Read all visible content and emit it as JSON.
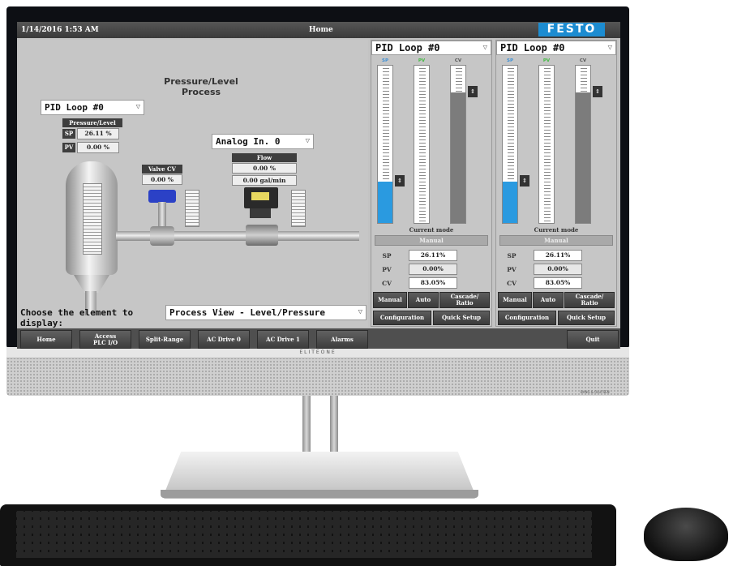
{
  "header": {
    "datetime": "1/14/2016 1:53 AM",
    "title": "Home",
    "logo": "FESTO"
  },
  "process": {
    "title_line1": "Pressure/Level",
    "title_line2": "Process",
    "loop_select": "PID Loop #0",
    "analog_select": "Analog In. 0",
    "pressure_level": {
      "label": "Pressure/Level",
      "sp_label": "SP",
      "sp_value": "26.11 %",
      "pv_label": "PV",
      "pv_value": "0.00 %"
    },
    "valve": {
      "label": "Valve CV",
      "value": "0.00 %"
    },
    "flow": {
      "label": "Flow",
      "percent": "0.00 %",
      "rate": "0.00   gal/min"
    },
    "choose_label": "Choose the element to display:",
    "choose_value": "Process View - Level/Pressure"
  },
  "pid_panels": [
    {
      "title": "PID Loop #0",
      "sp": "SP",
      "pv": "PV",
      "cv": "CV",
      "current_mode_label": "Current mode",
      "mode": "Manual",
      "sp_value": "26.11%",
      "pv_value": "0.00%",
      "cv_value": "83.05%",
      "buttons": {
        "manual": "Manual",
        "auto": "Auto",
        "cascade_1": "Cascade/",
        "cascade_2": "Ratio",
        "configuration": "Configuration",
        "quick_setup": "Quick Setup"
      },
      "levels": {
        "sp": 0.2611,
        "pv": 0.0,
        "cv": 0.8305
      }
    },
    {
      "title": "PID Loop #0",
      "sp": "SP",
      "pv": "PV",
      "cv": "CV",
      "current_mode_label": "Current mode",
      "mode": "Manual",
      "sp_value": "26.11%",
      "pv_value": "0.00%",
      "cv_value": "83.05%",
      "buttons": {
        "manual": "Manual",
        "auto": "Auto",
        "cascade_1": "Cascade/",
        "cascade_2": "Ratio",
        "configuration": "Configuration",
        "quick_setup": "Quick Setup"
      },
      "levels": {
        "sp": 0.2611,
        "pv": 0.0,
        "cv": 0.8305
      }
    }
  ],
  "nav": {
    "home": "Home",
    "access_1": "Access",
    "access_2": "PLC I/O",
    "split_range": "Split-Range",
    "ac_drive_0": "AC Drive 0",
    "ac_drive_1": "AC Drive 1",
    "alarms": "Alarms",
    "quit": "Quit"
  },
  "monitor": {
    "brand": "ELITEONE",
    "speaker_brand": "BANG & OLUFSEN"
  },
  "colors": {
    "accent": "#1c8cd1",
    "fill_blue": "#2a9ae0",
    "header_bg": "#4a4a4a"
  }
}
